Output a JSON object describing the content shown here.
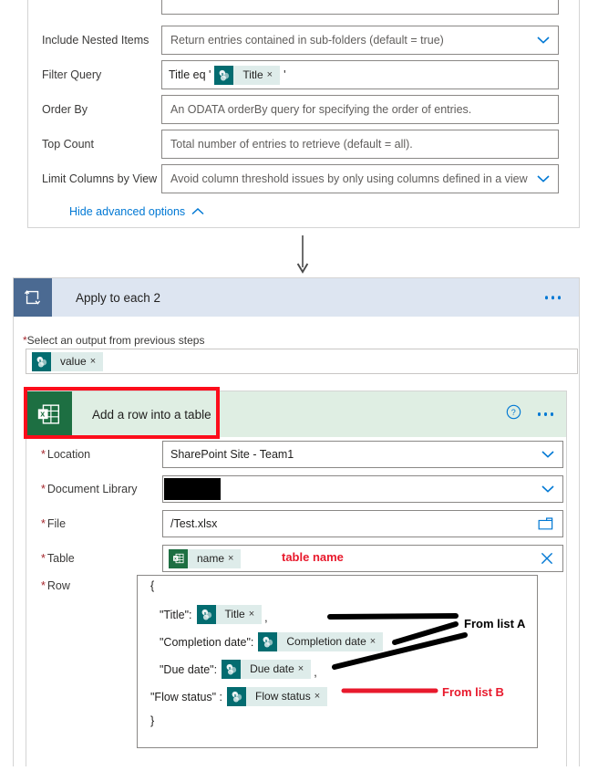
{
  "top_panel": {
    "partial_field_above": "",
    "fields": [
      {
        "label": "Include Nested Items",
        "placeholder": "Return entries contained in sub-folders (default = true)",
        "has_chevron": true,
        "required": false
      },
      {
        "label": "Filter Query",
        "required": false,
        "has_chevron": false
      },
      {
        "label": "Order By",
        "placeholder": "An ODATA orderBy query for specifying the order of entries.",
        "has_chevron": false,
        "required": false
      },
      {
        "label": "Top Count",
        "placeholder": "Total number of entries to retrieve (default = all).",
        "has_chevron": false,
        "required": false
      },
      {
        "label": "Limit Columns by View",
        "placeholder": "Avoid column threshold issues by only using columns defined in a view",
        "has_chevron": true,
        "required": false
      }
    ],
    "filter_query": {
      "prefix_text": "Title eq '",
      "token_label": "Title",
      "token_icon": "sharepoint-icon",
      "token_close": "×",
      "suffix_text": "'"
    },
    "hide_advanced_label": "Hide advanced options",
    "hide_advanced_caret": "chevron-up-icon"
  },
  "connector": {
    "icon": "down-arrow-icon"
  },
  "loop_card": {
    "icon": "apply-to-each-icon",
    "title": "Apply to each 2",
    "menu_icon": "ellipsis-icon",
    "select_output_label_required": "*",
    "select_output_label": "Select an output from previous steps",
    "selected_token": {
      "icon": "sharepoint-icon",
      "label": "value",
      "close": "×"
    }
  },
  "excel_card": {
    "icon": "excel-icon",
    "title": "Add a row into a table",
    "help_icon": "help-circle-icon",
    "menu_icon": "ellipsis-icon",
    "fields": [
      {
        "label": "Location",
        "value": "SharePoint Site - Team1",
        "required": true,
        "control": "dropdown"
      },
      {
        "label": "Document Library",
        "value": "",
        "required": true,
        "control": "dropdown",
        "redacted": true
      },
      {
        "label": "File",
        "value": "/Test.xlsx",
        "required": true,
        "control": "folder-picker"
      },
      {
        "label": "Table",
        "required": true,
        "control": "token"
      },
      {
        "label": "Row",
        "required": true,
        "control": "json-body"
      }
    ],
    "table_token": {
      "icon": "excel-table-icon",
      "label": "name",
      "close": "×",
      "clear_icon": "close-icon"
    },
    "row_body": {
      "open_brace": "{",
      "close_brace": "}",
      "entries": [
        {
          "key": "\"Title\":",
          "token_icon": "sharepoint-icon",
          "token_label": "Title",
          "token_close": "×",
          "trailing": ","
        },
        {
          "key": "\"Completion date\":",
          "token_icon": "sharepoint-icon",
          "token_label": "Completion date",
          "token_close": "×",
          "trailing": ""
        },
        {
          "key": "\"Due date\":",
          "token_icon": "sharepoint-icon",
          "token_label": "Due date",
          "token_close": "×",
          "trailing": ","
        },
        {
          "key": "\"Flow status\" :",
          "token_icon": "sharepoint-icon",
          "token_label": "Flow status",
          "token_close": "×",
          "trailing": ""
        }
      ]
    }
  },
  "annotations": {
    "table_name_note": "table name",
    "from_list_a": "From list A",
    "from_list_b": "From list B"
  },
  "colors": {
    "sharepoint_teal": "#036c70",
    "token_bg": "#deecea",
    "excel_green": "#1d6f42",
    "excel_header_bg": "#dfeee3",
    "loop_header_bg": "#dde5f1",
    "loop_icon_bg": "#4b6a92",
    "accent_blue": "#0078d4",
    "annotation_red": "#e8192c",
    "highlight_red": "#fc0d1b",
    "required_red": "#a4262c"
  }
}
